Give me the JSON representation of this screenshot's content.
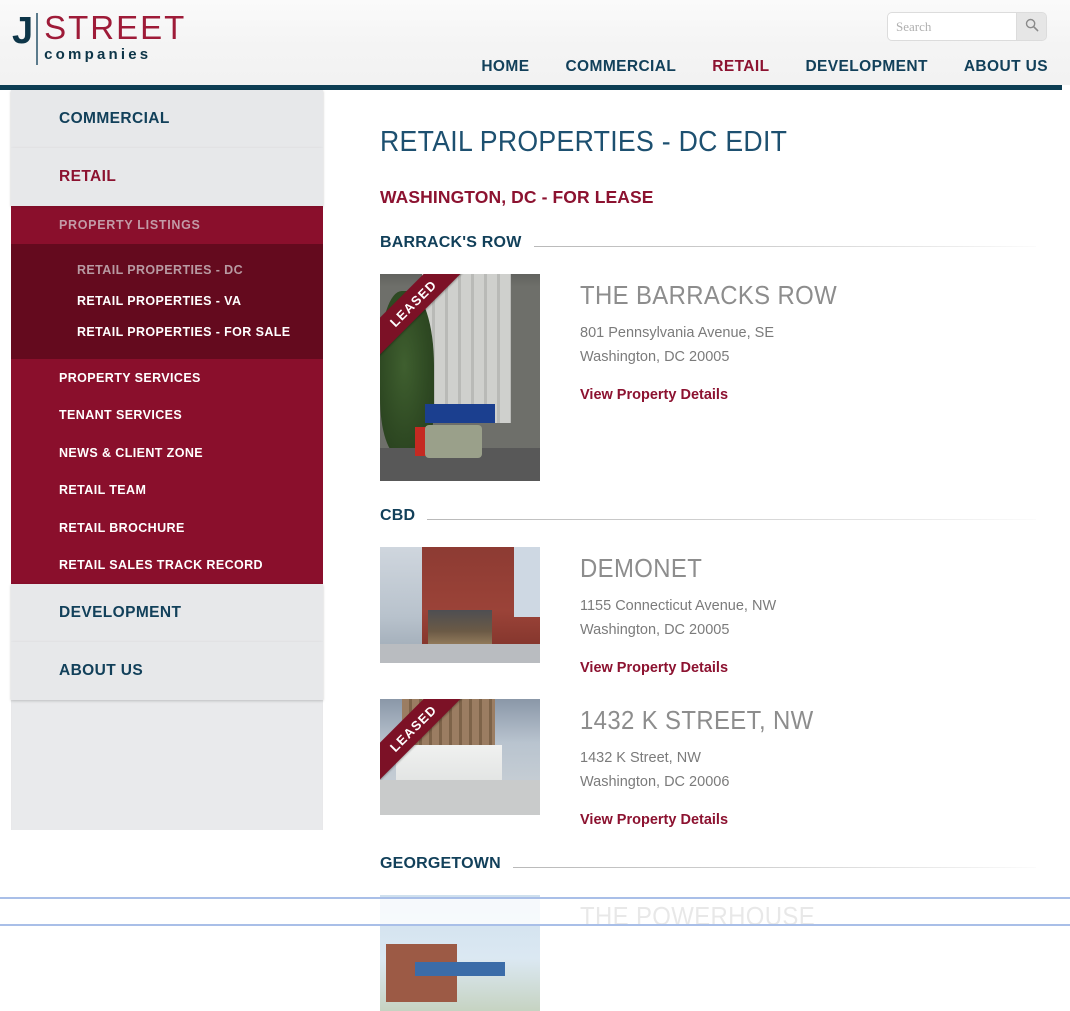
{
  "header": {
    "logo": {
      "j": "J",
      "street": "STREET",
      "companies": "companies"
    },
    "search": {
      "placeholder": "Search",
      "value": "",
      "icon": "search-icon"
    },
    "nav": [
      {
        "label": "HOME",
        "active": false
      },
      {
        "label": "COMMERCIAL",
        "active": false
      },
      {
        "label": "RETAIL",
        "active": true
      },
      {
        "label": "DEVELOPMENT",
        "active": false
      },
      {
        "label": "ABOUT US",
        "active": false
      }
    ]
  },
  "sidebar": {
    "items": [
      {
        "label": "COMMERCIAL"
      },
      {
        "label": "RETAIL"
      }
    ],
    "property_listings": "PROPERTY LISTINGS",
    "sub_items": [
      {
        "label": "RETAIL PROPERTIES - DC",
        "current": true
      },
      {
        "label": "RETAIL PROPERTIES - VA",
        "current": false
      },
      {
        "label": "RETAIL PROPERTIES - FOR SALE",
        "current": false
      }
    ],
    "red_items": [
      {
        "label": "PROPERTY SERVICES"
      },
      {
        "label": "TENANT SERVICES"
      },
      {
        "label": "NEWS & CLIENT ZONE"
      },
      {
        "label": "RETAIL TEAM"
      },
      {
        "label": "RETAIL BROCHURE"
      },
      {
        "label": "RETAIL SALES TRACK RECORD"
      }
    ],
    "bottom_items": [
      {
        "label": "DEVELOPMENT"
      },
      {
        "label": "ABOUT US"
      }
    ]
  },
  "main": {
    "page_title": "RETAIL PROPERTIES - DC EDIT",
    "sub_title": "WASHINGTON, DC - FOR LEASE",
    "details_label": "View Property Details",
    "ribbon_label": "LEASED",
    "sections": [
      {
        "label": "BARRACK'S ROW",
        "listings": [
          {
            "name": "THE BARRACKS ROW",
            "address1": "801 Pennsylvania Avenue, SE",
            "address2": "Washington, DC 20005",
            "leased": true
          }
        ]
      },
      {
        "label": "CBD",
        "listings": [
          {
            "name": "DEMONET",
            "address1": "1155 Connecticut Avenue, NW",
            "address2": "Washington, DC 20005",
            "leased": false
          },
          {
            "name": "1432 K STREET, NW",
            "address1": "1432 K Street, NW",
            "address2": "Washington, DC 20006",
            "leased": true
          }
        ]
      },
      {
        "label": "GEORGETOWN",
        "listings": [
          {
            "name": "THE POWERHOUSE",
            "address1": "",
            "address2": "",
            "leased": false
          }
        ]
      }
    ]
  },
  "colors": {
    "navy": "#0d3e54",
    "brand_red": "#8c1230",
    "sidebar_red": "#8a0f2c",
    "sidebar_red_dark": "#640a1e",
    "sidebar_grey": "#e7e8ea",
    "heading_blue": "#1d5070"
  }
}
